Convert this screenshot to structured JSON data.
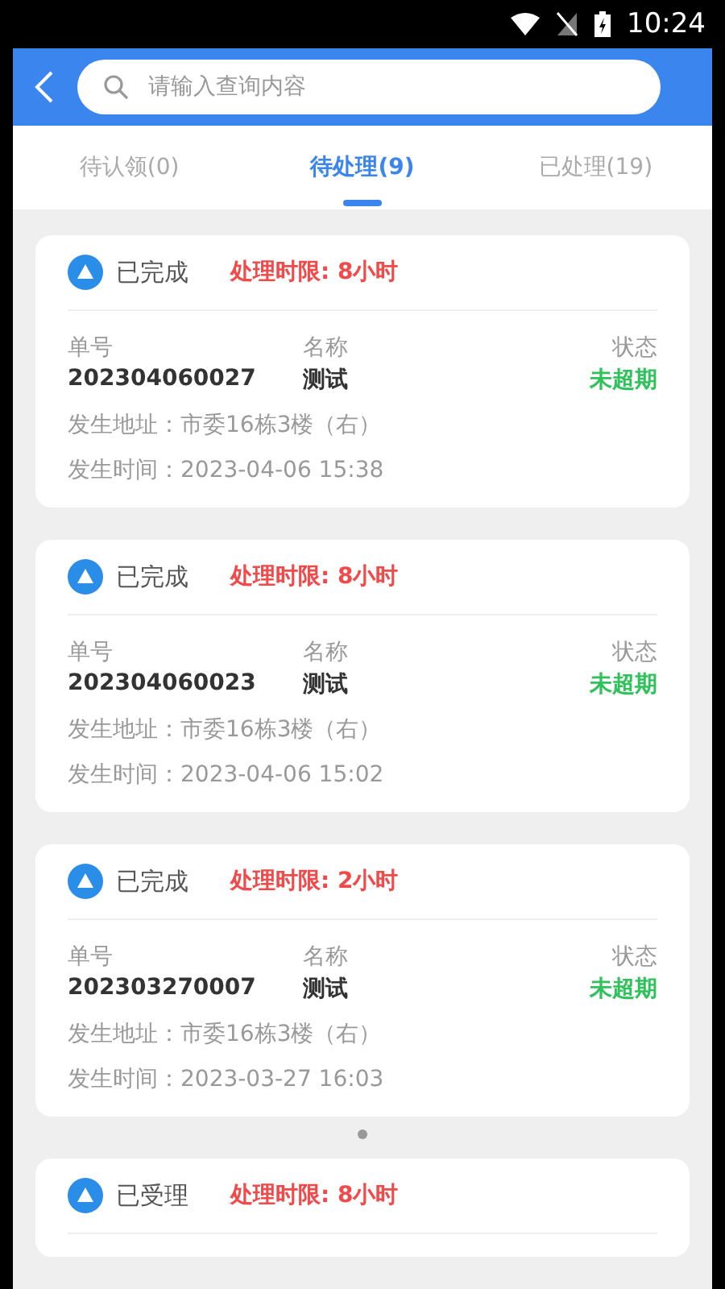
{
  "status_bar": {
    "time": "10:24"
  },
  "search": {
    "placeholder": "请输入查询内容"
  },
  "tabs": [
    {
      "label": "待认领(0)",
      "selected": false
    },
    {
      "label": "待处理(9)",
      "selected": true
    },
    {
      "label": "已处理(19)",
      "selected": false
    }
  ],
  "cards": [
    {
      "status": "已完成",
      "limit": "处理时限: 8小时",
      "columns": [
        "单号",
        "名称",
        "状态"
      ],
      "number": "202304060027",
      "name": "测试",
      "state": "未超期",
      "address": "发生地址：市委16栋3楼（右）",
      "time": "发生时间：2023-04-06 15:38"
    },
    {
      "status": "已完成",
      "limit": "处理时限: 8小时",
      "columns": [
        "单号",
        "名称",
        "状态"
      ],
      "number": "202304060023",
      "name": "测试",
      "state": "未超期",
      "address": "发生地址：市委16栋3楼（右）",
      "time": "发生时间：2023-04-06 15:02"
    },
    {
      "status": "已完成",
      "limit": "处理时限: 2小时",
      "columns": [
        "单号",
        "名称",
        "状态"
      ],
      "number": "202303270007",
      "name": "测试",
      "state": "未超期",
      "address": "发生地址：市委16栋3楼（右）",
      "time": "发生时间：2023-03-27 16:03"
    },
    {
      "status": "已受理",
      "limit": "处理时限: 8小时"
    }
  ]
}
